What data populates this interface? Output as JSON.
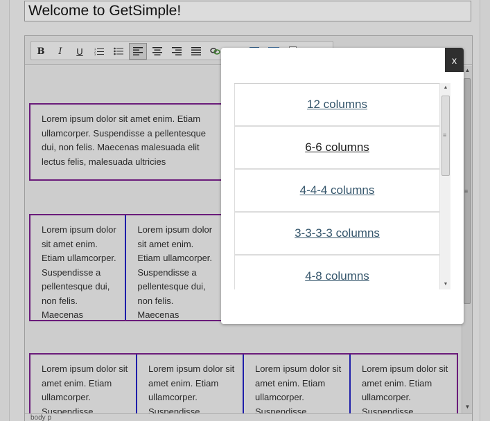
{
  "page": {
    "title_value": "Welcome to GetSimple!"
  },
  "toolbar": {
    "buttons": [
      {
        "name": "bold",
        "label": "B"
      },
      {
        "name": "italic",
        "label": "I"
      },
      {
        "name": "underline",
        "label": "U"
      },
      {
        "name": "numbered-list",
        "label": "numbered list"
      },
      {
        "name": "bulleted-list",
        "label": "bulleted list"
      },
      {
        "name": "align-left",
        "label": "align left"
      },
      {
        "name": "align-center",
        "label": "align center"
      },
      {
        "name": "align-right",
        "label": "align right"
      },
      {
        "name": "justify",
        "label": "justify"
      },
      {
        "name": "link",
        "label": "link"
      },
      {
        "name": "unlink",
        "label": "unlink"
      },
      {
        "name": "image",
        "label": "image"
      },
      {
        "name": "table",
        "label": "table"
      },
      {
        "name": "template",
        "label": "templates"
      }
    ],
    "active_button": "align-left"
  },
  "content": {
    "row1": {
      "text": "Lorem ipsum dolor sit amet enim. Etiam ullamcorper. Suspendisse a pellentesque dui, non felis. Maecenas malesuada elit lectus felis, malesuada ultricies"
    },
    "row2": {
      "col1": "Lorem ipsum dolor sit amet enim. Etiam ullamcorper. Suspendisse a pellentesque dui, non felis. Maecenas malesuada elit lectus felis, malesuada ultricies",
      "col2": "Lorem ipsum dolor sit amet enim. Etiam ullamcorper. Suspendisse a pellentesque dui, non felis. Maecenas malesuada elit lectus felis, malesuada ultricies"
    },
    "row3": {
      "col1": "Lorem ipsum dolor sit amet enim. Etiam ullamcorper. Suspendisse",
      "col2": "Lorem ipsum dolor sit amet enim. Etiam ullamcorper. Suspendisse",
      "col3": "Lorem ipsum dolor sit amet enim. Etiam ullamcorper. Suspendisse",
      "col4": "Lorem ipsum dolor sit amet enim. Etiam ullamcorper. Suspendisse"
    }
  },
  "statusbar": {
    "path": "body p"
  },
  "modal": {
    "close_label": "x",
    "items": [
      {
        "label": "12 columns"
      },
      {
        "label": "6-6 columns"
      },
      {
        "label": "4-4-4 columns"
      },
      {
        "label": "3-3-3-3 columns"
      },
      {
        "label": "4-8 columns"
      }
    ],
    "hovered_item": "6-6 columns"
  },
  "colors": {
    "row_border": "#6a1b7a",
    "column_border": "#1e1eaa",
    "link": "#35566c",
    "close_bg": "#2f2f2f"
  }
}
